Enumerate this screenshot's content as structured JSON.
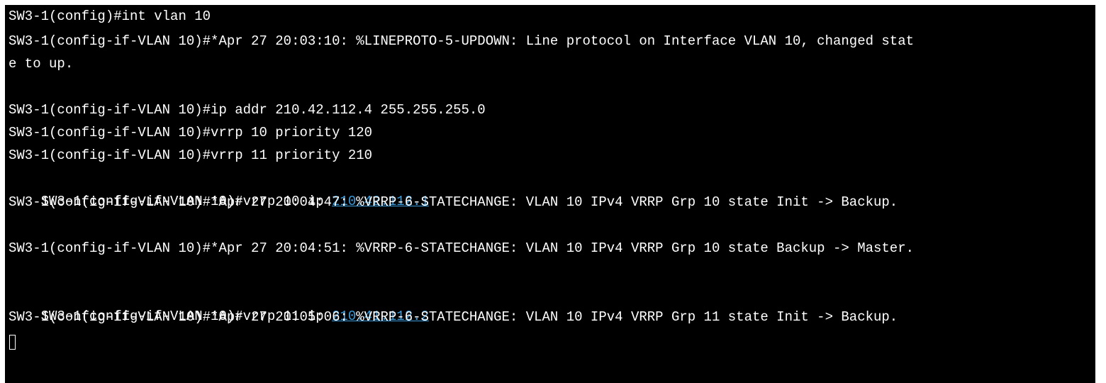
{
  "terminal": {
    "lines": [
      "SW3-1(config)#int vlan 10",
      "SW3-1(config-if-VLAN 10)#*Apr 27 20:03:10: %LINEPROTO-5-UPDOWN: Line protocol on Interface VLAN 10, changed stat",
      "e to up.",
      "",
      "SW3-1(config-if-VLAN 10)#ip addr 210.42.112.4 255.255.255.0",
      "SW3-1(config-if-VLAN 10)#vrrp 10 priority 120",
      "SW3-1(config-if-VLAN 10)#vrrp 11 priority 210",
      "SW3-1(config-if-VLAN 10)#vrrp 10 ip ",
      "SW3-1(config-if-VLAN 10)#*Apr 27 20:04:47: %VRRP-6-STATECHANGE: VLAN 10 IPv4 VRRP Grp 10 state Init -> Backup.",
      "",
      "SW3-1(config-if-VLAN 10)#*Apr 27 20:04:51: %VRRP-6-STATECHANGE: VLAN 10 IPv4 VRRP Grp 10 state Backup -> Master.",
      "",
      "SW3-1(config-if-VLAN 10)#vrrp 11 ip ",
      "SW3-1(config-if-VLAN 10)#*Apr 27 20:05:06: %VRRP-6-STATECHANGE: VLAN 10 IPv4 VRRP Grp 11 state Init -> Backup."
    ],
    "links": {
      "vrrp10_ip": "210.42.112.1",
      "vrrp11_ip": "210.41.112.2"
    },
    "colors": {
      "background": "#000000",
      "text": "#ffffff",
      "link": "#3a9ad9"
    }
  }
}
